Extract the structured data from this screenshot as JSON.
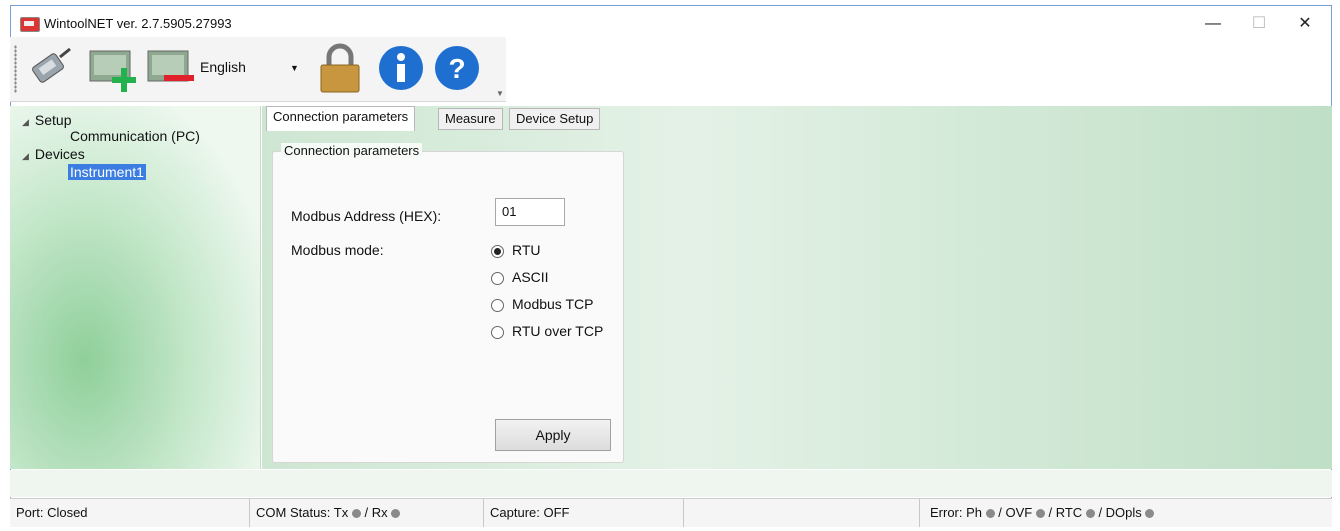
{
  "window": {
    "title": "WintoolNET ver. 2.7.5905.27993",
    "minimize_label": "—",
    "maximize_label": "☐",
    "close_label": "✕"
  },
  "toolbar": {
    "icons": [
      "connect-plug-icon",
      "add-device-icon",
      "remove-device-icon",
      "lock-icon",
      "info-icon",
      "help-icon"
    ],
    "language": "English"
  },
  "tree": {
    "setup_label": "Setup",
    "setup_child": "Communication (PC)",
    "devices_label": "Devices",
    "devices_child": "Instrument1"
  },
  "tabs": [
    "Connection parameters",
    "Measure",
    "Device Setup"
  ],
  "connection": {
    "group_title": "Connection parameters",
    "address_label": "Modbus Address (HEX):",
    "address_value": "01",
    "mode_label": "Modbus mode:",
    "modes": [
      "RTU",
      "ASCII",
      "Modbus TCP",
      "RTU over TCP"
    ],
    "selected_mode": "RTU",
    "apply_label": "Apply"
  },
  "status": {
    "port": "Port:  Closed",
    "com_prefix": "COM Status: Tx",
    "com_mid": " / Rx",
    "capture": "Capture:  OFF",
    "error_prefix": "Error:  Ph",
    "error_ovf": " / OVF",
    "error_rtc": " / RTC",
    "error_dopls": " / DOpls"
  },
  "colors": {
    "accent_selection": "#3b7de0",
    "panel_green": "#c6e8cc",
    "indicator_gray": "#8a8a8a"
  }
}
